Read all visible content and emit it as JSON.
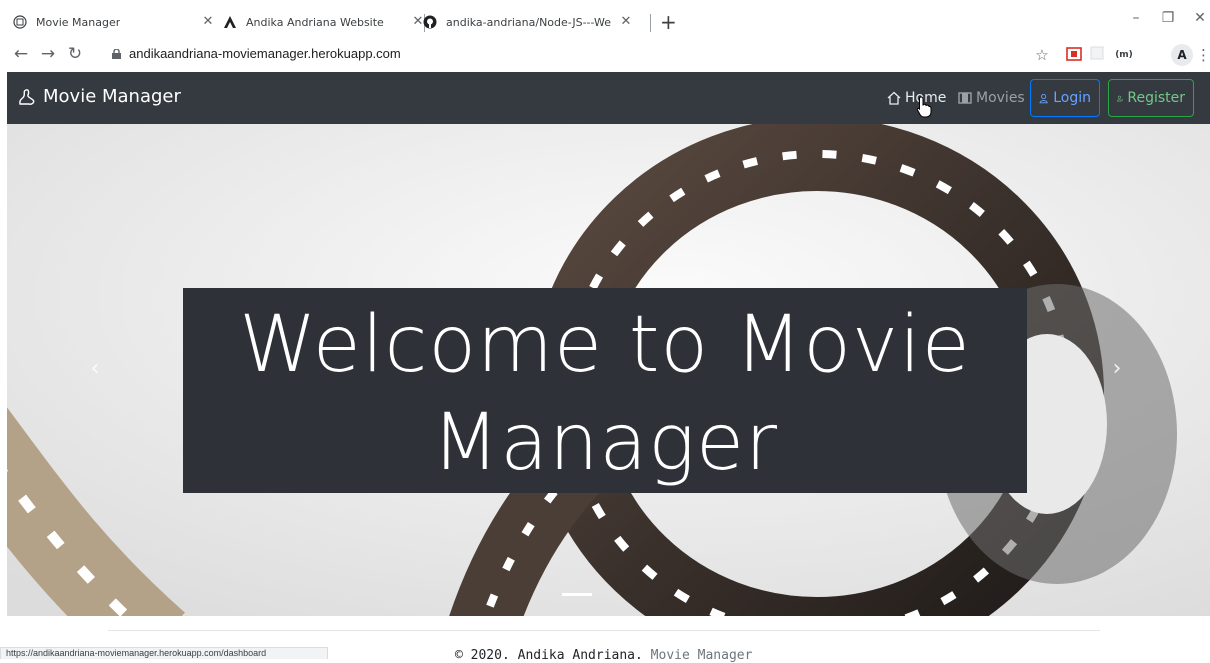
{
  "browser": {
    "tabs": [
      {
        "title": "Movie Manager",
        "active": true
      },
      {
        "title": "Andika Andriana Website",
        "active": false
      },
      {
        "title": "andika-andriana/Node-JS---Web",
        "active": false
      }
    ],
    "new_tab": "+",
    "address": "andikaandriana-moviemanager.herokuapp.com",
    "profile_initial": "A",
    "extension_label": "(m)"
  },
  "navbar": {
    "brand": "Movie Manager",
    "home": "Home",
    "movies": "Movies",
    "login": "Login",
    "register": "Register"
  },
  "carousel": {
    "heading_line1": "Welcome to Movie",
    "heading_line2": "Manager",
    "prev": "‹",
    "next": "›"
  },
  "footer": {
    "copyright": "© 2020. Andika Andriana.",
    "app_name": "Movie Manager"
  },
  "status_url": "https://andikaandriana-moviemanager.herokuapp.com/dashboard",
  "colors": {
    "navbar_bg": "#343a40",
    "login_border": "#007bff",
    "register_border": "#28a745"
  }
}
